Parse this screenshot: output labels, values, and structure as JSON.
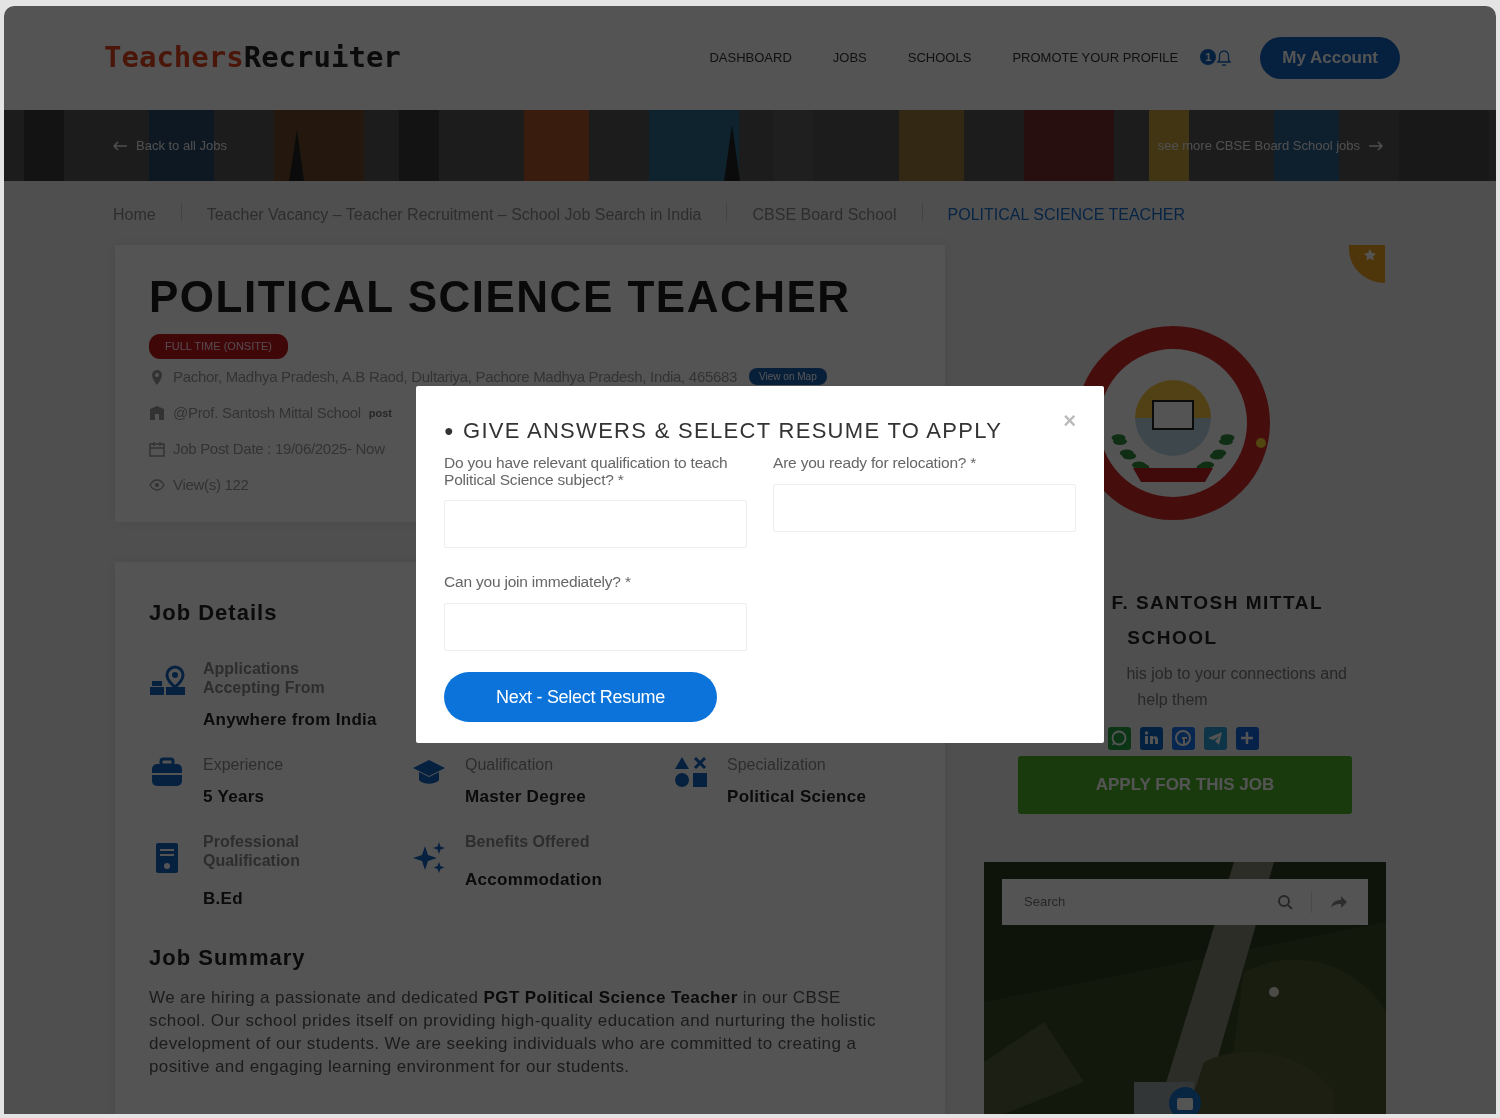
{
  "header": {
    "logo": {
      "first": "Teachers",
      "second": "Recruiter"
    },
    "nav": [
      {
        "label": "DASHBOARD"
      },
      {
        "label": "JOBS"
      },
      {
        "label": "SCHOOLS"
      },
      {
        "label": "PROMOTE YOUR PROFILE"
      }
    ],
    "notification_count": "1",
    "account_button": "My Account"
  },
  "banner": {
    "back_link": "Back to all Jobs",
    "more_link": "see more CBSE Board School jobs"
  },
  "breadcrumbs": [
    {
      "label": "Home",
      "selected": false
    },
    {
      "label": "Teacher Vacancy – Teacher Recruitment – School Job Search in India",
      "selected": false
    },
    {
      "label": "CBSE Board School",
      "selected": false
    },
    {
      "label": "POLITICAL SCIENCE TEACHER",
      "selected": true
    }
  ],
  "job": {
    "title": "POLITICAL SCIENCE TEACHER",
    "type_badge": "FULL TIME (ONSITE)",
    "meta": [
      {
        "kind": "location",
        "text": "Pachor, Madhya Pradesh, A.B Raod, Dultariya, Pachore Madhya Pradesh, India, 465683",
        "button": "View on Map"
      },
      {
        "kind": "school",
        "text": "@Prof. Santosh Mittal School",
        "note": "post"
      },
      {
        "kind": "date",
        "text": "Job Post Date : 19/06/2025- Now"
      },
      {
        "kind": "views",
        "text": "View(s) 122"
      }
    ]
  },
  "details": {
    "title": "Job Details",
    "rows": [
      [
        {
          "kind": "map-people",
          "label": "Applications Accepting From",
          "value": "Anywhere from India"
        }
      ],
      [
        {
          "kind": "briefcase",
          "label": "Experience",
          "value": "5 Years"
        },
        {
          "kind": "cap",
          "label": "Qualification",
          "value": "Master Degree"
        },
        {
          "kind": "shapes",
          "label": "Specialization",
          "value": "Political Science"
        }
      ],
      [
        {
          "kind": "document",
          "label": "Professional Qualification",
          "value": "B.Ed"
        },
        {
          "kind": "sparkles",
          "label": "Benefits Offered",
          "value": "Accommodation"
        }
      ]
    ]
  },
  "summary": {
    "title": "Job Summary",
    "text": "We are hiring a passionate and dedicated **PGT Political Science Teacher** in our CBSE school. Our school prides itself on providing high-quality education and nurturing the holistic development of our students. We are seeking individuals who are committed to creating a positive and engaging learning environment for our students."
  },
  "school": {
    "name_lines": [
      "F. SANTOSH MITTAL",
      "SCHOOL"
    ],
    "share_lines": [
      "his job to your connections and",
      "help them"
    ],
    "apply_button": "APPLY FOR THIS JOB"
  },
  "map": {
    "search_placeholder": "Search"
  },
  "modal": {
    "bullet": "●",
    "title": "GIVE ANSWERS & SELECT RESUME TO APPLY",
    "close": "×",
    "questions": [
      {
        "label": "Do you have relevant qualification to teach Political Science subject? *"
      },
      {
        "label": "Are you ready for relocation? *"
      },
      {
        "label": "Can you join immediately? *"
      }
    ],
    "submit": "Next - Select Resume"
  }
}
